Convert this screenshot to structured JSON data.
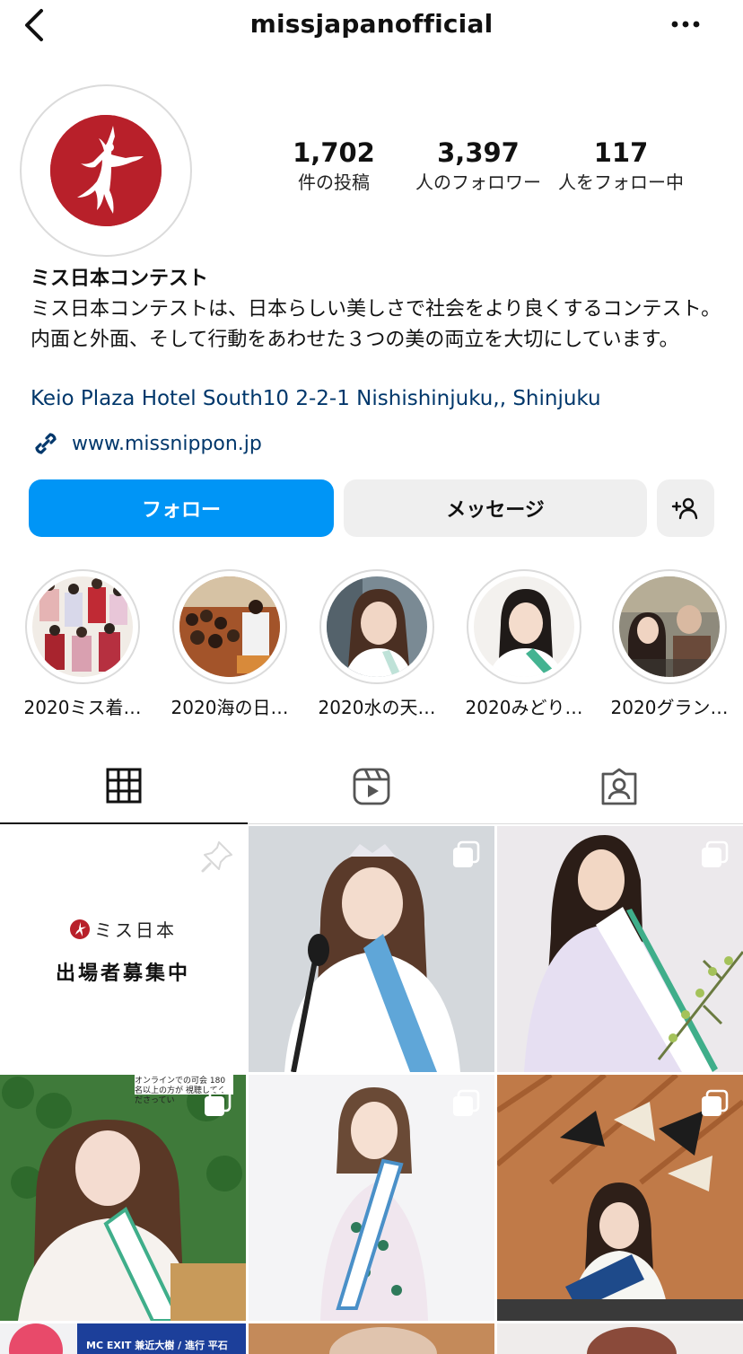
{
  "header": {
    "username": "missjapanofficial"
  },
  "stats": [
    {
      "value": "1,702",
      "label": "件の投稿"
    },
    {
      "value": "3,397",
      "label": "人のフォロワー"
    },
    {
      "value": "117",
      "label": "人をフォロー中"
    }
  ],
  "profile": {
    "name": "ミス日本コンテスト",
    "bio": "ミス日本コンテストは、日本らしい美しさで社会をより良くするコンテスト。内面と外面、そして行動をあわせた３つの美の両立を大切にしています。",
    "address": "Keio Plaza Hotel South10 2-2-1 Nishishinjuku,, Shinjuku",
    "link": "www.missnippon.jp"
  },
  "actions": {
    "follow": "フォロー",
    "message": "メッセージ"
  },
  "highlights": [
    {
      "label": "2020ミス着…"
    },
    {
      "label": "2020海の日…"
    },
    {
      "label": "2020水の天…"
    },
    {
      "label": "2020みどり…"
    },
    {
      "label": "2020グラン…"
    }
  ],
  "posts": {
    "pinned": {
      "brand": "ミス日本",
      "headline": "出場者募集中"
    },
    "overlay_top": "オンラインでの可会 180名以上の方が 視聴してくださってい",
    "overlay_bottom": "MC EXIT 兼近大樹 / 進行 平石"
  },
  "colors": {
    "accent": "#0095f6",
    "link": "#00376b",
    "brand_red": "#b8202a",
    "sash_green": "#3fae8a"
  }
}
